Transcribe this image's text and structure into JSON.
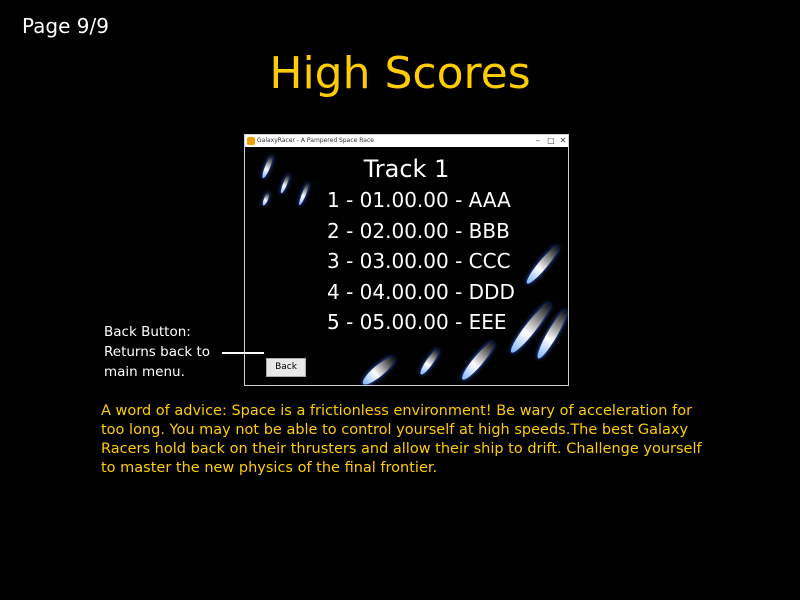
{
  "page_indicator": "Page 9/9",
  "title": "High Scores",
  "window": {
    "title": "GalaxyRacer - A Pampered Space Race",
    "minimize": "–",
    "maximize": "□",
    "close": "✕",
    "track": "Track 1",
    "scores": [
      "1 - 01.00.00 - AAA",
      "2 - 02.00.00 - BBB",
      "3 - 03.00.00 - CCC",
      "4 - 04.00.00 - DDD",
      "5 - 05.00.00 - EEE"
    ],
    "back_button": "Back"
  },
  "annotation": {
    "lines": [
      "Back Button:",
      "Returns back to",
      "main menu."
    ]
  },
  "advice": "A word of advice: Space is a frictionless environment! Be wary of acceleration for too long. You may not be able to control yourself at high speeds.The best Galaxy Racers hold back on their thrusters and allow their ship to drift. Challenge yourself to master the new physics of the final frontier.",
  "colors": {
    "accent": "#ffcc00",
    "background": "#000000",
    "text": "#ffffff"
  }
}
